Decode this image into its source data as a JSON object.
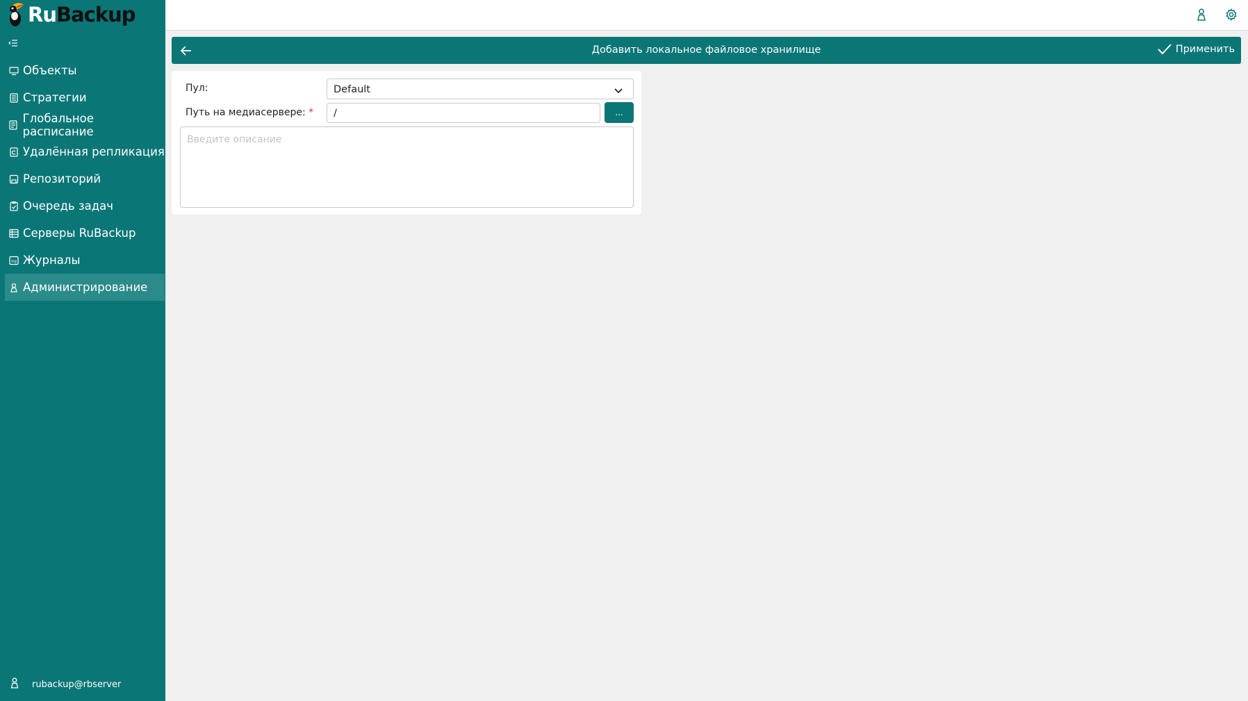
{
  "app": {
    "logo_ru": "Ru",
    "logo_backup": "Backup",
    "colors": {
      "primary": "#0b7676",
      "active_item": "#2b8a8a",
      "background": "#f0f0f0",
      "required": "#dd3333"
    }
  },
  "sidebar": {
    "items": [
      {
        "label": "Объекты",
        "icon": "monitor-icon"
      },
      {
        "label": "Стратегии",
        "icon": "strategy-icon"
      },
      {
        "label": "Глобальное расписание",
        "icon": "schedule-icon"
      },
      {
        "label": "Удалённая репликация",
        "icon": "replication-icon"
      },
      {
        "label": "Репозиторий",
        "icon": "repository-icon"
      },
      {
        "label": "Очередь задач",
        "icon": "task-queue-icon"
      },
      {
        "label": "Серверы RuBackup",
        "icon": "servers-icon"
      },
      {
        "label": "Журналы",
        "icon": "log-icon"
      },
      {
        "label": "Администрирование",
        "icon": "admin-icon",
        "active": true
      }
    ],
    "user": "rubackup@rbserver"
  },
  "header": {
    "title": "Добавить локальное файловое хранилище",
    "apply_label": "Применить"
  },
  "form": {
    "pool_label": "Пул:",
    "pool_value": "Default",
    "path_label": "Путь на медиасервере:",
    "path_required": "*",
    "path_value": "/",
    "browse_label": "...",
    "description_placeholder": "Введите описание"
  }
}
